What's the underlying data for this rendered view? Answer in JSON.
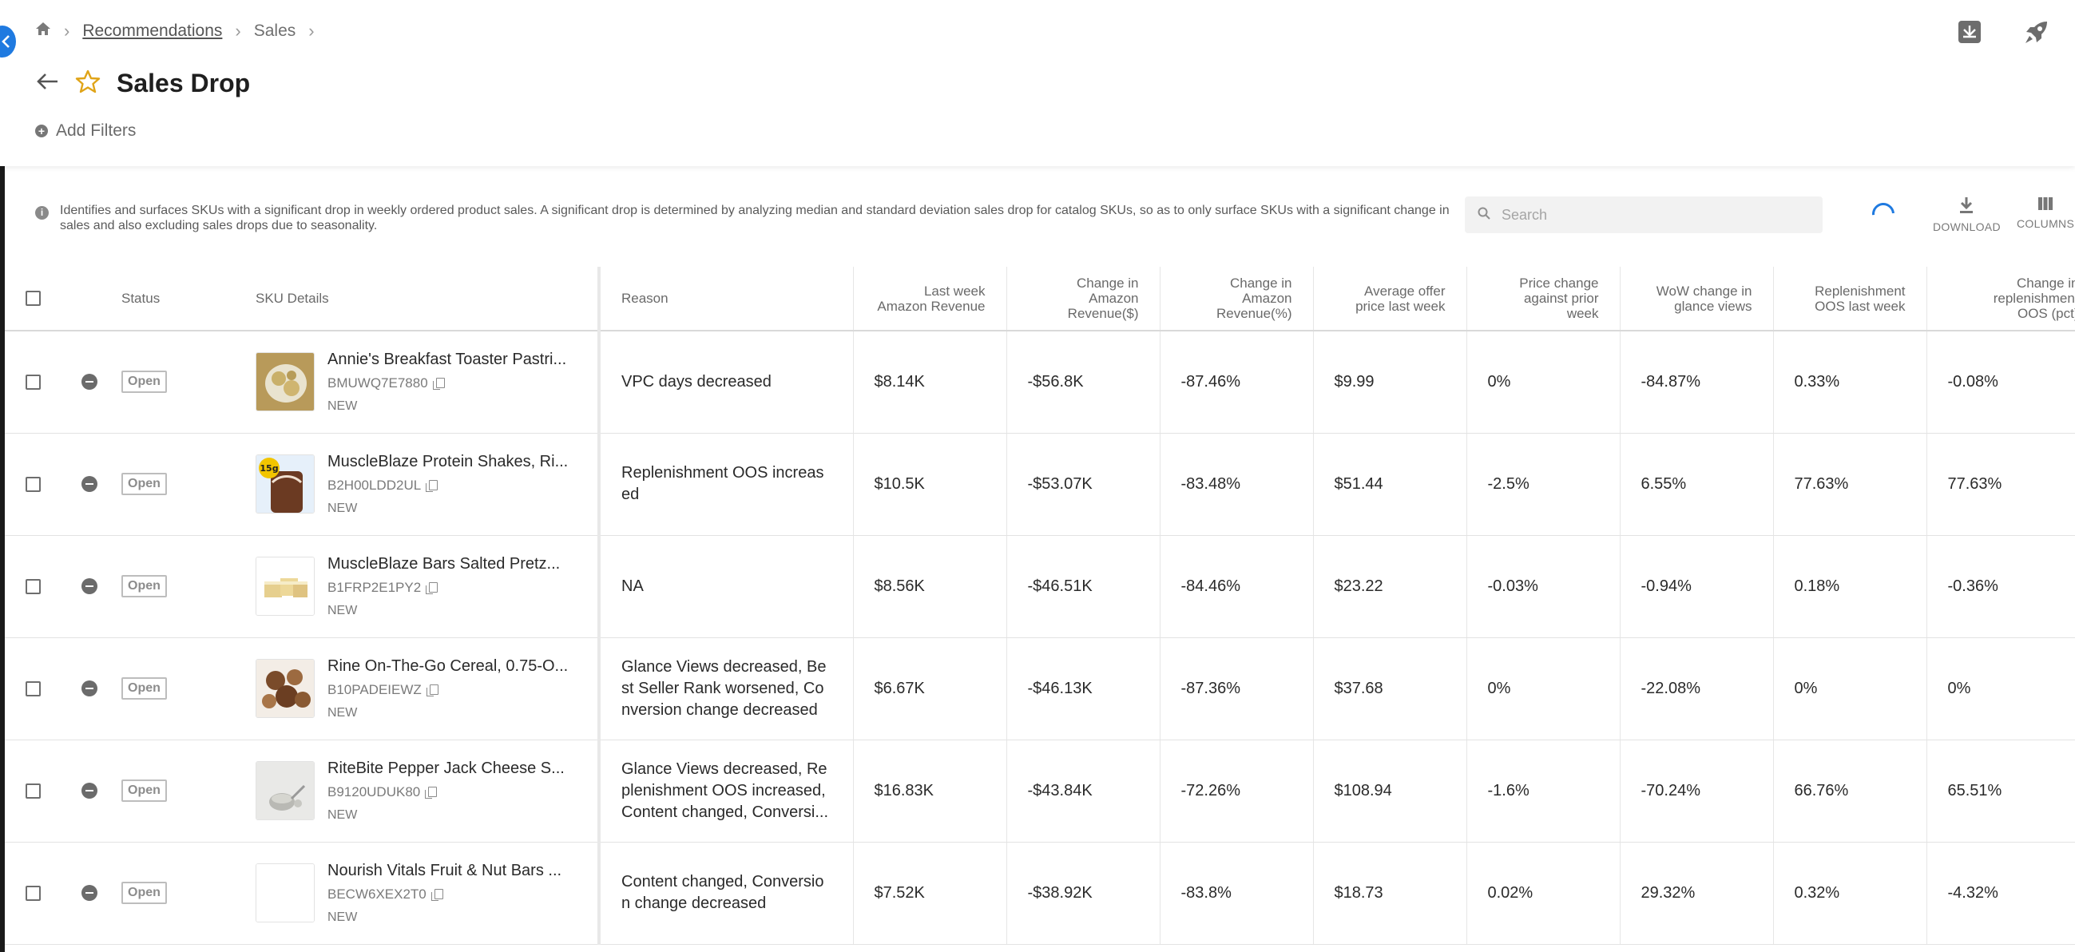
{
  "breadcrumb": {
    "home_icon": "home-icon",
    "link": "Recommendations",
    "current": "Sales"
  },
  "page": {
    "title": "Sales Drop",
    "add_filters": "Add Filters"
  },
  "info": {
    "text": "Identifies and surfaces SKUs with a significant drop in weekly ordered product sales. A significant drop is determined by analyzing median and standard deviation sales drop for catalog SKUs, so as to only surface SKUs with a significant change in sales and also excluding sales drops due to seasonality."
  },
  "search": {
    "placeholder": "Search"
  },
  "toolbar": {
    "download": "DOWNLOAD",
    "columns": "COLUMNS"
  },
  "table": {
    "headers": {
      "status": "Status",
      "sku": "SKU Details",
      "reason": "Reason",
      "last_week_rev": [
        "Last week",
        "Amazon Revenue"
      ],
      "change_rev_abs": [
        "Change in",
        "Amazon",
        "Revenue($)"
      ],
      "change_rev_pct": [
        "Change in",
        "Amazon",
        "Revenue(%)"
      ],
      "avg_offer": [
        "Average offer",
        "price last week"
      ],
      "price_change": [
        "Price change",
        "against prior",
        "week"
      ],
      "wow_glance": [
        "WoW change in",
        "glance views"
      ],
      "repl_oos": [
        "Replenishment",
        "OOS last week"
      ],
      "change_repl": [
        "Change in",
        "replenishment",
        "OOS (pct)"
      ]
    },
    "rows": [
      {
        "status": "Open",
        "name": "Annie's Breakfast Toaster Pastri...",
        "sku": "BMUWQ7E7880",
        "tag": "NEW",
        "reason": "VPC days decreased",
        "last_week": "$8.14K",
        "chg_abs": "-$56.8K",
        "chg_pct": "-87.46%",
        "avg_price": "$9.99",
        "price_chg": "0%",
        "wow": "-84.87%",
        "repl": "0.33%",
        "repl_chg": "-0.08%"
      },
      {
        "status": "Open",
        "name": "MuscleBlaze Protein Shakes, Ri...",
        "sku": "B2H00LDD2UL",
        "tag": "NEW",
        "reason": "Replenishment OOS increased",
        "last_week": "$10.5K",
        "chg_abs": "-$53.07K",
        "chg_pct": "-83.48%",
        "avg_price": "$51.44",
        "price_chg": "-2.5%",
        "wow": "6.55%",
        "repl": "77.63%",
        "repl_chg": "77.63%"
      },
      {
        "status": "Open",
        "name": "MuscleBlaze Bars Salted Pretz...",
        "sku": "B1FRP2E1PY2",
        "tag": "NEW",
        "reason": "NA",
        "last_week": "$8.56K",
        "chg_abs": "-$46.51K",
        "chg_pct": "-84.46%",
        "avg_price": "$23.22",
        "price_chg": "-0.03%",
        "wow": "-0.94%",
        "repl": "0.18%",
        "repl_chg": "-0.36%"
      },
      {
        "status": "Open",
        "name": "Rine On-The-Go Cereal, 0.75-O...",
        "sku": "B10PADEIEWZ",
        "tag": "NEW",
        "reason": "Glance Views decreased, Best Seller Rank worsened, Conversion change decreased",
        "last_week": "$6.67K",
        "chg_abs": "-$46.13K",
        "chg_pct": "-87.36%",
        "avg_price": "$37.68",
        "price_chg": "0%",
        "wow": "-22.08%",
        "repl": "0%",
        "repl_chg": "0%"
      },
      {
        "status": "Open",
        "name": "RiteBite Pepper Jack Cheese S...",
        "sku": "B9120UDUK80",
        "tag": "NEW",
        "reason": "Glance Views decreased, Replenishment OOS increased, Content changed, Conversi...",
        "last_week": "$16.83K",
        "chg_abs": "-$43.84K",
        "chg_pct": "-72.26%",
        "avg_price": "$108.94",
        "price_chg": "-1.6%",
        "wow": "-70.24%",
        "repl": "66.76%",
        "repl_chg": "65.51%"
      },
      {
        "status": "Open",
        "name": "Nourish Vitals Fruit & Nut Bars ...",
        "sku": "BECW6XEX2T0",
        "tag": "NEW",
        "reason": "Content changed, Conversion change decreased",
        "last_week": "$7.52K",
        "chg_abs": "-$38.92K",
        "chg_pct": "-83.8%",
        "avg_price": "$18.73",
        "price_chg": "0.02%",
        "wow": "29.32%",
        "repl": "0.32%",
        "repl_chg": "-4.32%"
      }
    ]
  }
}
